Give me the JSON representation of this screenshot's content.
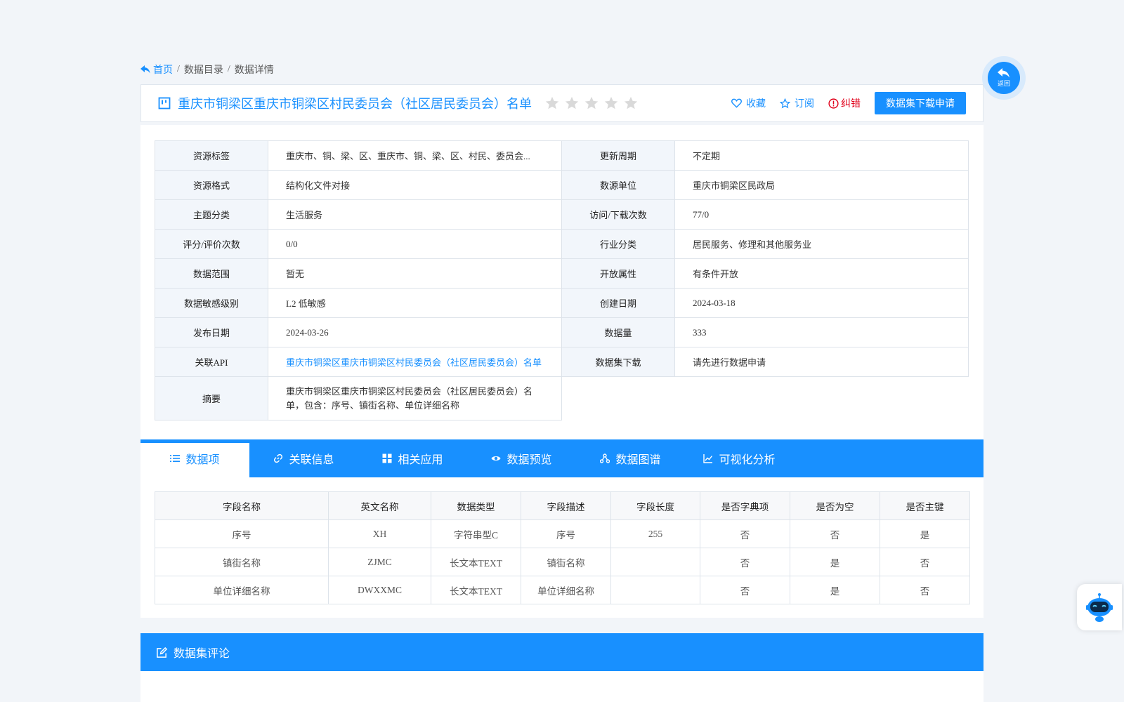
{
  "breadcrumb": {
    "home": "首页",
    "sep1": "/",
    "catalog": "数据目录",
    "sep2": "/",
    "detail": "数据详情"
  },
  "title": {
    "text": "重庆市铜梁区重庆市铜梁区村民委员会（社区居民委员会）名单",
    "rating_stars": 0,
    "rating_max": 5,
    "favorite": "收藏",
    "subscribe": "订阅",
    "report_error": "纠错",
    "apply_button": "数据集下载申请"
  },
  "info": {
    "rows": [
      {
        "k1": "资源标签",
        "v1": "重庆市、铜、梁、区、重庆市、铜、梁、区、村民、委员会...",
        "k2": "更新周期",
        "v2": "不定期"
      },
      {
        "k1": "资源格式",
        "v1": "结构化文件对接",
        "k2": "数源单位",
        "v2": "重庆市铜梁区民政局"
      },
      {
        "k1": "主题分类",
        "v1": "生活服务",
        "k2": "访问/下载次数",
        "v2": "77/0"
      },
      {
        "k1": "评分/评价次数",
        "v1": "0/0",
        "k2": "行业分类",
        "v2": "居民服务、修理和其他服务业"
      },
      {
        "k1": "数据范围",
        "v1": "暂无",
        "k2": "开放属性",
        "v2": "有条件开放"
      },
      {
        "k1": "数据敏感级别",
        "v1": "L2 低敏感",
        "k2": "创建日期",
        "v2": "2024-03-18"
      },
      {
        "k1": "发布日期",
        "v1": "2024-03-26",
        "k2": "数据量",
        "v2": "333"
      },
      {
        "k1": "关联API",
        "v1": "重庆市铜梁区重庆市铜梁区村民委员会（社区居民委员会）名单",
        "k2": "数据集下载",
        "v2": "请先进行数据申请"
      }
    ],
    "summary_label": "摘要",
    "summary_value": "重庆市铜梁区重庆市铜梁区村民委员会（社区居民委员会）名单，包含：序号、镇街名称、单位详细名称"
  },
  "tabs": [
    {
      "label": "数据项",
      "icon": "list-icon"
    },
    {
      "label": "关联信息",
      "icon": "link-icon"
    },
    {
      "label": "相关应用",
      "icon": "grid-icon"
    },
    {
      "label": "数据预览",
      "icon": "eye-icon"
    },
    {
      "label": "数据图谱",
      "icon": "graph-icon"
    },
    {
      "label": "可视化分析",
      "icon": "line-chart-icon"
    }
  ],
  "fields": {
    "headers": [
      "字段名称",
      "英文名称",
      "数据类型",
      "字段描述",
      "字段长度",
      "是否字典项",
      "是否为空",
      "是否主键"
    ],
    "rows": [
      [
        "序号",
        "XH",
        "字符串型C",
        "序号",
        "255",
        "否",
        "否",
        "是"
      ],
      [
        "镇街名称",
        "ZJMC",
        "长文本TEXT",
        "镇街名称",
        "",
        "否",
        "是",
        "否"
      ],
      [
        "单位详细名称",
        "DWXXMC",
        "长文本TEXT",
        "单位详细名称",
        "",
        "否",
        "是",
        "否"
      ]
    ]
  },
  "comments": {
    "title": "数据集评论"
  },
  "float": {
    "back_label": "返回"
  },
  "colors": {
    "primary": "#1890ff",
    "error": "#e0001a",
    "star_empty": "#d9d9d9"
  }
}
